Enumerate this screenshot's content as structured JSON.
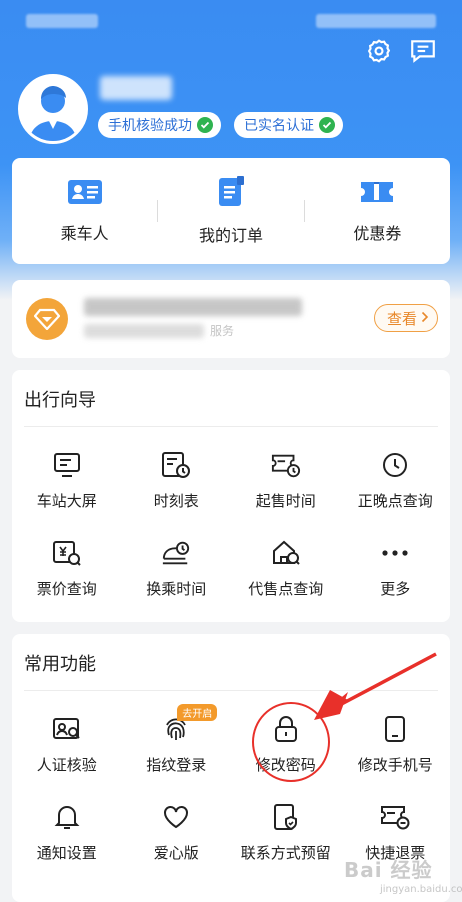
{
  "header": {
    "verify_badges": [
      {
        "label": "手机核验成功"
      },
      {
        "label": "已实名认证"
      }
    ]
  },
  "quick_actions": [
    {
      "label": "乘车人",
      "icon": "passenger-card-icon"
    },
    {
      "label": "我的订单",
      "icon": "order-list-icon"
    },
    {
      "label": "优惠券",
      "icon": "coupon-icon"
    }
  ],
  "member": {
    "service_suffix": "服务",
    "view_label": "查看"
  },
  "guide": {
    "title": "出行向导",
    "items": [
      {
        "label": "车站大屏",
        "icon": "station-screen-icon"
      },
      {
        "label": "时刻表",
        "icon": "timetable-icon"
      },
      {
        "label": "起售时间",
        "icon": "sale-time-icon"
      },
      {
        "label": "正晚点查询",
        "icon": "clock-icon"
      },
      {
        "label": "票价查询",
        "icon": "fare-query-icon"
      },
      {
        "label": "换乘时间",
        "icon": "transfer-train-icon"
      },
      {
        "label": "代售点查询",
        "icon": "agency-house-icon"
      },
      {
        "label": "更多",
        "icon": "more-dots-icon"
      }
    ]
  },
  "common": {
    "title": "常用功能",
    "items": [
      {
        "label": "人证核验",
        "icon": "id-verify-icon"
      },
      {
        "label": "指纹登录",
        "icon": "fingerprint-icon",
        "tag": "去开启"
      },
      {
        "label": "修改密码",
        "icon": "lock-icon"
      },
      {
        "label": "修改手机号",
        "icon": "phone-icon"
      },
      {
        "label": "通知设置",
        "icon": "bell-icon"
      },
      {
        "label": "爱心版",
        "icon": "heart-icon"
      },
      {
        "label": "联系方式预留",
        "icon": "contact-shield-icon"
      },
      {
        "label": "快捷退票",
        "icon": "refund-ticket-icon"
      }
    ]
  },
  "watermark": {
    "text": "Bai 经验",
    "sub": "jingyan.baidu.com"
  },
  "colors": {
    "primary": "#3a8cf2",
    "accent_orange": "#f3a53a",
    "annotation_red": "#e8302a",
    "verify_green": "#2fb350"
  }
}
